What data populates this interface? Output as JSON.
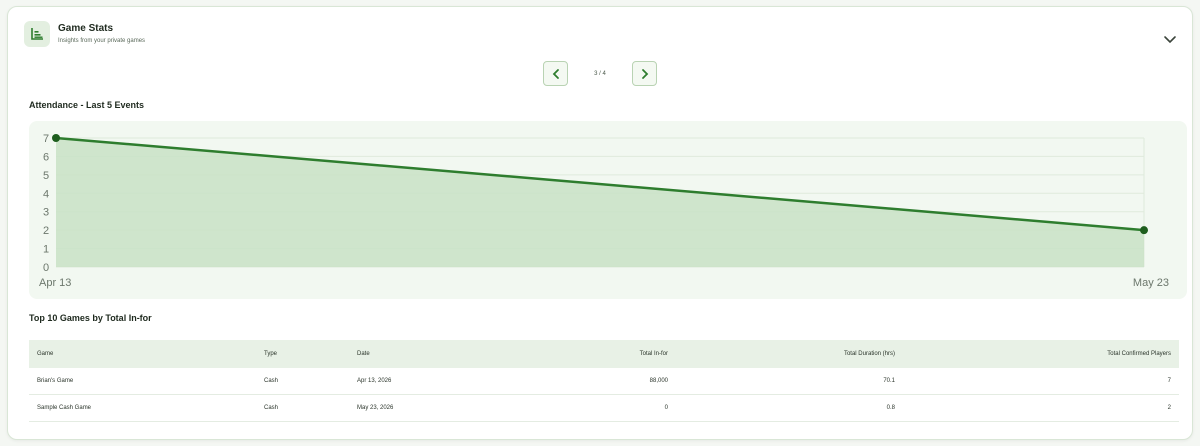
{
  "header": {
    "title": "Game Stats",
    "subtitle": "Insights from your private games"
  },
  "pager": {
    "label": "3 / 4"
  },
  "attendance": {
    "title": "Attendance - Last 5 Events"
  },
  "chart_data": {
    "type": "area",
    "title": "Attendance - Last 5 Events",
    "x": [
      "Apr 13",
      "May 23"
    ],
    "values": [
      7,
      2
    ],
    "yticks": [
      0,
      1,
      2,
      3,
      4,
      5,
      6,
      7
    ],
    "ylim": [
      0,
      7
    ],
    "grid": true,
    "colors": {
      "line": "#2e7d2e",
      "fill": "#c9e2c6",
      "point": "#1e5e1e"
    }
  },
  "top_games": {
    "title": "Top 10 Games by Total In-for",
    "columns": [
      "Game",
      "Type",
      "Date",
      "Total In-for",
      "Total Duration (hrs)",
      "Total Confirmed Players"
    ],
    "rows": [
      [
        "Brian's Game",
        "Cash",
        "Apr 13, 2026",
        "88,000",
        "70.1",
        "7"
      ],
      [
        "Sample Cash Game",
        "Cash",
        "May 23, 2026",
        "0",
        "0.8",
        "2"
      ]
    ]
  },
  "icons": {
    "header": "bar-chart-icon",
    "collapse": "chevron-down-icon",
    "prev": "chevron-left-icon",
    "next": "chevron-right-icon"
  },
  "colors": {
    "accent": "#2e7d2e"
  }
}
